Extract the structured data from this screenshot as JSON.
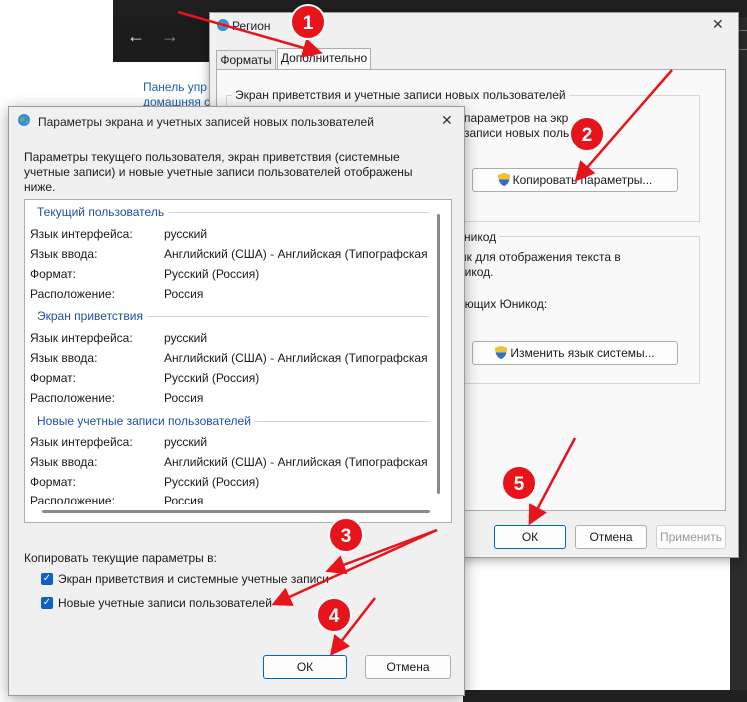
{
  "background": {
    "nav_back": "←",
    "nav_forward": "→",
    "panel_link_line1": "Панель упр",
    "panel_link_line2": "домашняя с"
  },
  "region_dialog": {
    "title": "Регион",
    "tabs": [
      "Форматы",
      "Дополнительно"
    ],
    "welcome_group": {
      "title": "Экран приветствия и учетные записи новых пользователей",
      "text_line1": "параметров на экр",
      "text_line2": "записи новых польз",
      "copy_button": "Копировать параметры..."
    },
    "unicode_group": {
      "title_fragment": "никод",
      "text_line1": "ык для отображения текста в",
      "text_line2": "никод.",
      "text_line3": "ающих Юникод:",
      "change_button": "Изменить язык системы..."
    },
    "buttons": {
      "ok": "ОК",
      "cancel": "Отмена",
      "apply": "Применить"
    }
  },
  "params_dialog": {
    "title": "Параметры экрана и учетных записей новых пользователей",
    "description": "Параметры текущего пользователя, экран приветствия (системные учетные записи) и новые учетные записи пользователей отображены ниже.",
    "sections": [
      {
        "title": "Текущий пользователь",
        "rows": [
          {
            "label": "Язык интерфейса:",
            "value": "русский"
          },
          {
            "label": "Язык ввода:",
            "value": "Английский (США) - Английская (Типографская"
          },
          {
            "label": "Формат:",
            "value": "Русский (Россия)"
          },
          {
            "label": "Расположение:",
            "value": "Россия"
          }
        ]
      },
      {
        "title": "Экран приветствия",
        "rows": [
          {
            "label": "Язык интерфейса:",
            "value": "русский"
          },
          {
            "label": "Язык ввода:",
            "value": "Английский (США) - Английская (Типографская"
          },
          {
            "label": "Формат:",
            "value": "Русский (Россия)"
          },
          {
            "label": "Расположение:",
            "value": "Россия"
          }
        ]
      },
      {
        "title": "Новые учетные записи пользователей",
        "rows": [
          {
            "label": "Язык интерфейса:",
            "value": "русский"
          },
          {
            "label": "Язык ввода:",
            "value": "Английский (США) - Английская (Типографская"
          },
          {
            "label": "Формат:",
            "value": "Русский (Россия)"
          },
          {
            "label": "Расположение:",
            "value": "Россия"
          }
        ]
      }
    ],
    "copy_label": "Копировать текущие параметры в:",
    "checkboxes": [
      {
        "label": "Экран приветствия и системные учетные записи",
        "checked": true
      },
      {
        "label": "Новые учетные записи пользователей",
        "checked": true
      }
    ],
    "buttons": {
      "ok": "ОК",
      "cancel": "Отмена"
    }
  },
  "annotations": {
    "badges": [
      "1",
      "2",
      "3",
      "4",
      "5"
    ],
    "color": "#e8141b"
  }
}
